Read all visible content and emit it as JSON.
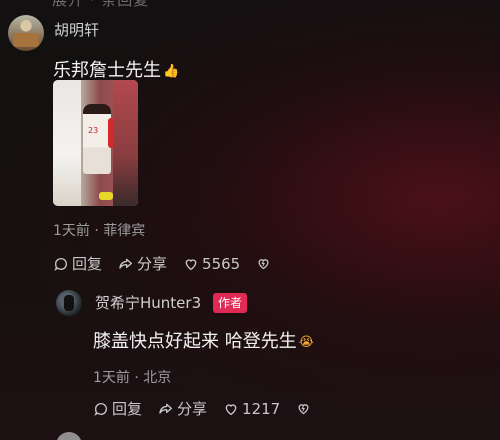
{
  "top_partial_text": "展开 · 条回复",
  "comment1": {
    "username": "胡明轩",
    "text": "乐邦詹士先生",
    "emoji": "👍",
    "meta": "1天前 · 菲律宾",
    "reply_label": "回复",
    "share_label": "分享",
    "like_count": "5565",
    "icons": [
      "reply-icon",
      "share-icon",
      "heart-icon",
      "dislike-icon"
    ]
  },
  "comment2": {
    "username": "贺希宁Hunter3",
    "author_tag": "作者",
    "text": "膝盖快点好起来 哈登先生",
    "emoji": "😭",
    "meta": "1天前 · 北京",
    "reply_label": "回复",
    "share_label": "分享",
    "like_count": "1217",
    "icons": [
      "reply-icon",
      "share-icon",
      "heart-icon",
      "dislike-icon"
    ]
  },
  "colors": {
    "background": "#140c0e",
    "author_tag": "#e02a55",
    "text_primary": "#f2f2f2",
    "text_secondary": "#9c9c9e"
  }
}
